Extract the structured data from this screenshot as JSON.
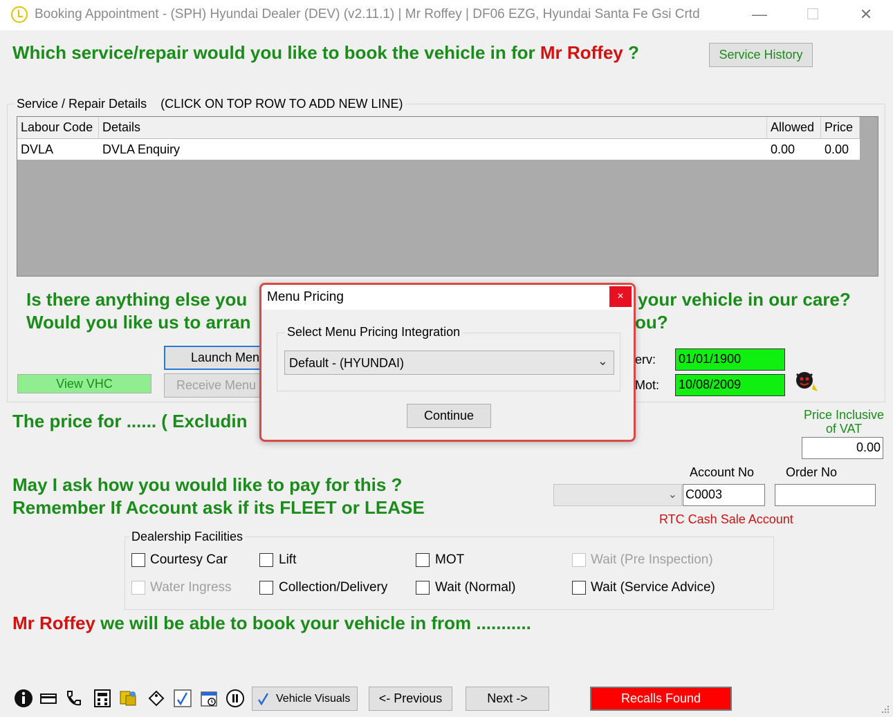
{
  "window": {
    "title": "Booking Appointment - (SPH) Hyundai Dealer (DEV) (v2.11.1) | Mr Roffey | DF06 EZG, Hyundai Santa Fe Gsi Crtd",
    "minimize": "—",
    "maximize": "☐",
    "close": "✕"
  },
  "header": {
    "question_pre": "Which service/repair would you like to book the vehicle in for ",
    "customer_name": "Mr Roffey",
    "question_post": " ?",
    "service_history_label": "Service History"
  },
  "details": {
    "group_label": "Service / Repair Details",
    "instruction": "(CLICK ON TOP ROW TO ADD NEW LINE)",
    "columns": [
      "Labour Code",
      "Details",
      "Allowed",
      "Price"
    ],
    "rows": [
      {
        "labour_code": "DVLA",
        "details": "DVLA Enquiry",
        "allowed": "0.00",
        "price": "0.00"
      }
    ]
  },
  "anything_else": {
    "line1_left": "Is there anything else you",
    "line1_right": "your vehicle in our care?",
    "line2_left": "Would you like us to arran",
    "line2_right": "ou?"
  },
  "buttons": {
    "launch_menu": "Launch Men",
    "receive_menu": "Receive Menu",
    "view_vhc": "View VHC"
  },
  "dates": {
    "serv_label": "erv:",
    "serv_value": "01/01/1900",
    "mot_label": "Mot:",
    "mot_value": "10/08/2009"
  },
  "price": {
    "text": "The price for ...... ( Excludin",
    "inclusive_label_1": "Price Inclusive",
    "inclusive_label_2": "of VAT",
    "value": "0.00"
  },
  "payment": {
    "line1": "May I ask how you would like to pay for this ?",
    "line2": "Remember If Account  ask if its FLEET or LEASE",
    "account_no_label": "Account No",
    "account_no_value": "C0003",
    "order_no_label": "Order No",
    "order_no_value": "",
    "account_name": "RTC Cash Sale Account"
  },
  "facilities": {
    "group_label": "Dealership Facilities",
    "courtesy_car": "Courtesy Car",
    "lift": "Lift",
    "mot": "MOT",
    "wait_pre": "Wait (Pre Inspection)",
    "water_ingress": "Water Ingress",
    "collection": "Collection/Delivery",
    "wait_normal": "Wait (Normal)",
    "wait_service": "Wait (Service Advice)"
  },
  "booking": {
    "customer_name": "Mr Roffey",
    "text": " we will be able to book your vehicle in from ..........."
  },
  "footer": {
    "vehicle_visuals": "Vehicle Visuals",
    "previous": "<- Previous",
    "next": "Next ->",
    "recalls": "Recalls Found",
    "recalls_color": "#ff0000"
  },
  "dialog": {
    "title": "Menu Pricing",
    "close": "×",
    "group_label": "Select Menu Pricing Integration",
    "selected": "Default - (HYUNDAI)",
    "continue": "Continue"
  }
}
